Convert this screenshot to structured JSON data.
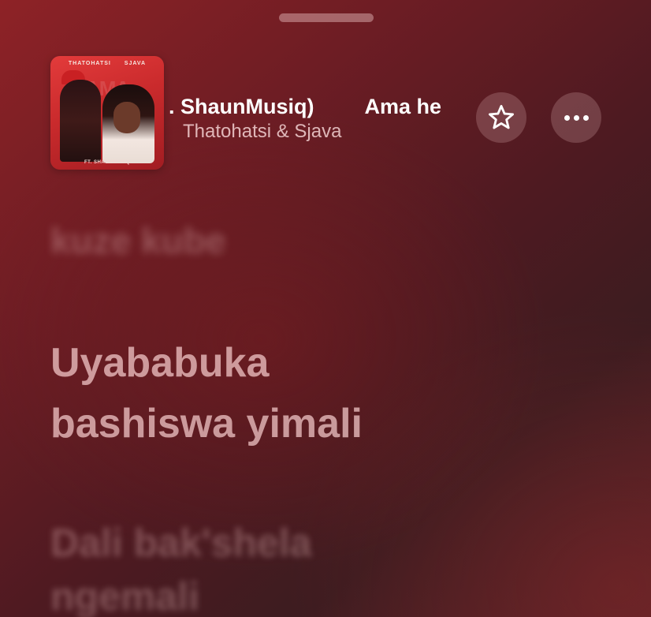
{
  "now_playing": {
    "title_visible": ". ShaunMusiq)",
    "title_next_loop": "Ama he",
    "artist": "Thatohatsi & Sjava",
    "artwork": {
      "header": "THATOHATSI SJAVA",
      "footer": "FT. SHAUNMUSIQ",
      "letters": "AMA"
    }
  },
  "actions": {
    "favorite_icon": "star-icon",
    "more_icon": "ellipsis-icon"
  },
  "lyrics": {
    "faded_top": "",
    "previous": "kuze kube",
    "current": [
      "Uyababuka",
      "bashiswa yimali"
    ],
    "next": [
      "Dali bak'shela",
      "ngemali"
    ]
  },
  "colors": {
    "background_top_left": "#8e2226",
    "background_dark": "#3c1c20",
    "text_primary": "#ffffff"
  }
}
